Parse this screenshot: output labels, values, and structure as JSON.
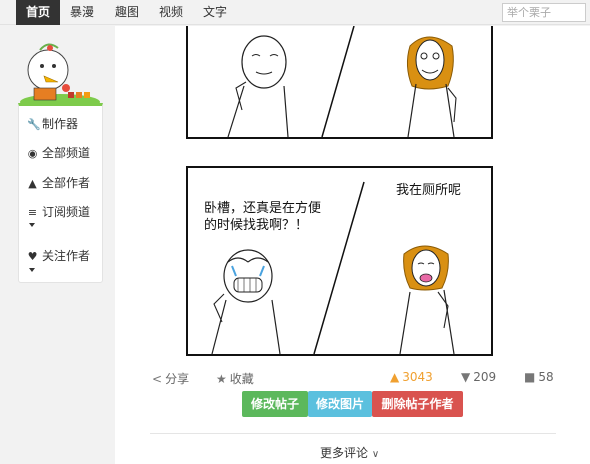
{
  "nav": {
    "items": [
      "首页",
      "暴漫",
      "趣图",
      "视频",
      "文字"
    ],
    "active_index": 0
  },
  "search": {
    "placeholder": "举个栗子"
  },
  "sidebar": {
    "items": [
      {
        "label": "制作器",
        "icon": "wrench-icon",
        "has_caret": false
      },
      {
        "label": "全部频道",
        "icon": "compass-icon",
        "has_caret": false
      },
      {
        "label": "全部作者",
        "icon": "user-icon",
        "has_caret": false
      },
      {
        "label": "订阅频道",
        "icon": "rss-icon",
        "has_caret": true
      },
      {
        "label": "关注作者",
        "icon": "heart-icon",
        "has_caret": true
      }
    ]
  },
  "comic": {
    "panel2": {
      "left_caption": [
        "卧槽，还真是在方便",
        "的时候找我啊？！"
      ],
      "right_caption": "我在厕所呢"
    }
  },
  "actions": {
    "share": "分享",
    "favorite": "收藏",
    "likes": "3043",
    "dislikes": "209",
    "comments": "58"
  },
  "buttons": {
    "edit_post": "修改帖子",
    "edit_image": "修改图片",
    "delete_author": "删除帖子作者"
  },
  "more_comments": "更多评论",
  "colors": {
    "nav_active_bg": "#333333",
    "green": "#5cb85c",
    "blue": "#5bc0de",
    "red": "#d9534f",
    "like_color": "#f0a030"
  }
}
